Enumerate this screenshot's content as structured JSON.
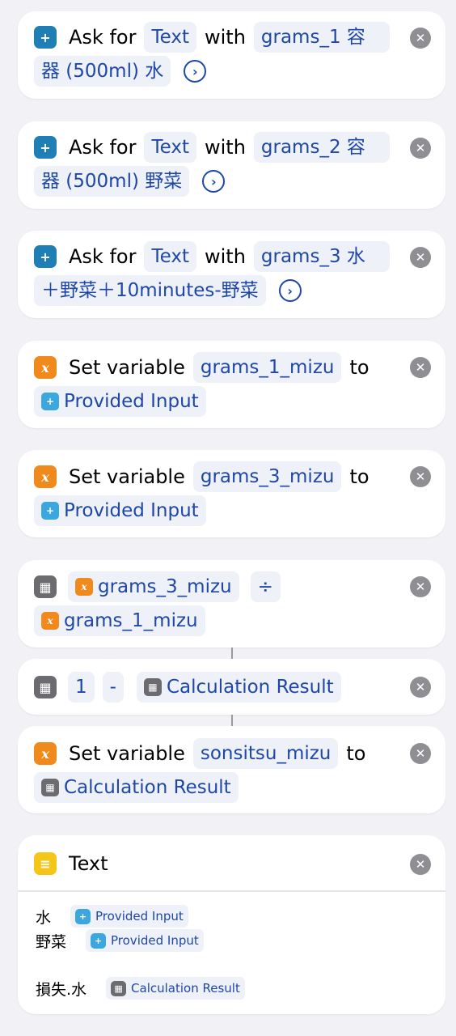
{
  "cards": {
    "ask1": {
      "ask": "Ask for",
      "type": "Text",
      "with": "with",
      "prompt_a": "grams_1 容",
      "prompt_b": "器 (500ml) 水"
    },
    "ask2": {
      "ask": "Ask for",
      "type": "Text",
      "with": "with",
      "prompt_a": "grams_2 容",
      "prompt_b": "器 (500ml) 野菜"
    },
    "ask3": {
      "ask": "Ask for",
      "type": "Text",
      "with": "with",
      "prompt_a": "grams_3 水",
      "prompt_b": "＋野菜＋10minutes-野菜"
    },
    "set1": {
      "set": "Set variable",
      "var": "grams_1_mizu",
      "to": "to",
      "value": "Provided Input"
    },
    "set2": {
      "set": "Set variable",
      "var": "grams_3_mizu",
      "to": "to",
      "value": "Provided Input"
    },
    "calc1": {
      "a": "grams_3_mizu",
      "op": "÷",
      "b": "grams_1_mizu"
    },
    "calc2": {
      "a": "1",
      "op": "-",
      "b": "Calculation Result"
    },
    "set3": {
      "set": "Set variable",
      "var": "sonsitsu_mizu",
      "to": "to",
      "value": "Calculation Result"
    },
    "text": {
      "title": "Text",
      "line1_label": "水",
      "line1_value": "Provided Input",
      "line2_label": "野菜",
      "line2_value": "Provided Input",
      "line3_label": "損失.水",
      "line3_value": "Calculation Result"
    }
  },
  "icons": {
    "ask": "ask-for-input-icon",
    "variable": "set-variable-icon",
    "calculate": "calculate-icon",
    "text": "text-icon",
    "close": "close-icon",
    "chevron": "chevron-right-circle-icon"
  },
  "colors": {
    "token_text": "#1f47a8",
    "token_bg": "#eef1f7",
    "ask_icon": "#1f7fb5",
    "variable_icon": "#f08a1c",
    "calc_icon": "#6b6b70",
    "text_icon": "#f5c518",
    "background": "#f1f1f6"
  }
}
